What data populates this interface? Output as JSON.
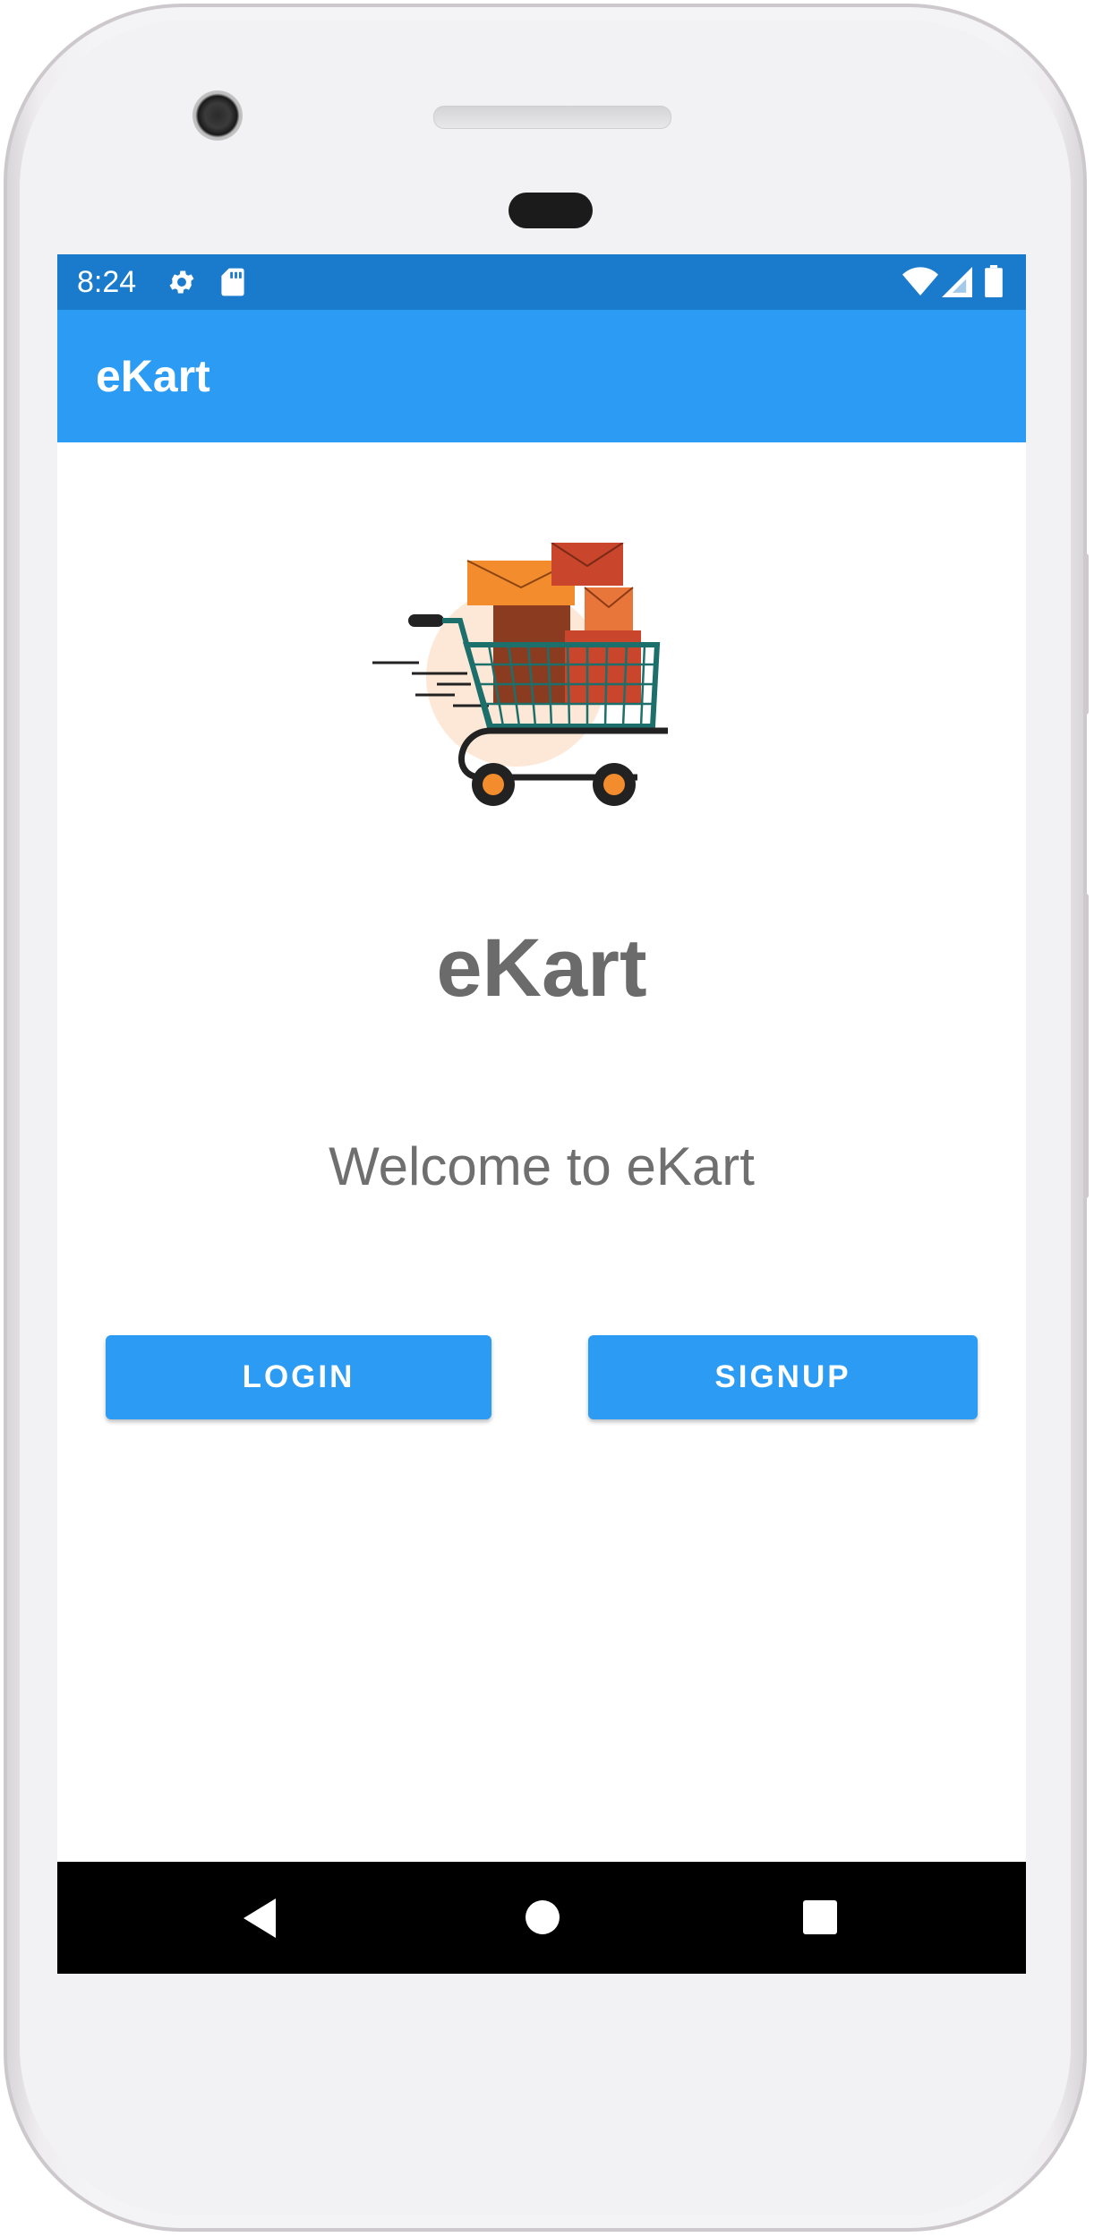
{
  "status_bar": {
    "time": "8:24",
    "icons": [
      "gear-icon",
      "sd-card-icon",
      "wifi-icon",
      "signal-icon",
      "battery-icon"
    ]
  },
  "app_bar": {
    "title": "eKart"
  },
  "main": {
    "logo": "shopping-cart-illustration",
    "brand": "eKart",
    "welcome": "Welcome to eKart",
    "login_label": "LOGIN",
    "signup_label": "SIGNUP"
  },
  "nav_bar": {
    "icons": [
      "back-icon",
      "home-icon",
      "recents-icon"
    ]
  },
  "colors": {
    "status_bar": "#1a7bcc",
    "app_bar": "#2b9bf3",
    "button": "#2b9bf3",
    "text_gray": "#6b6b6b"
  }
}
